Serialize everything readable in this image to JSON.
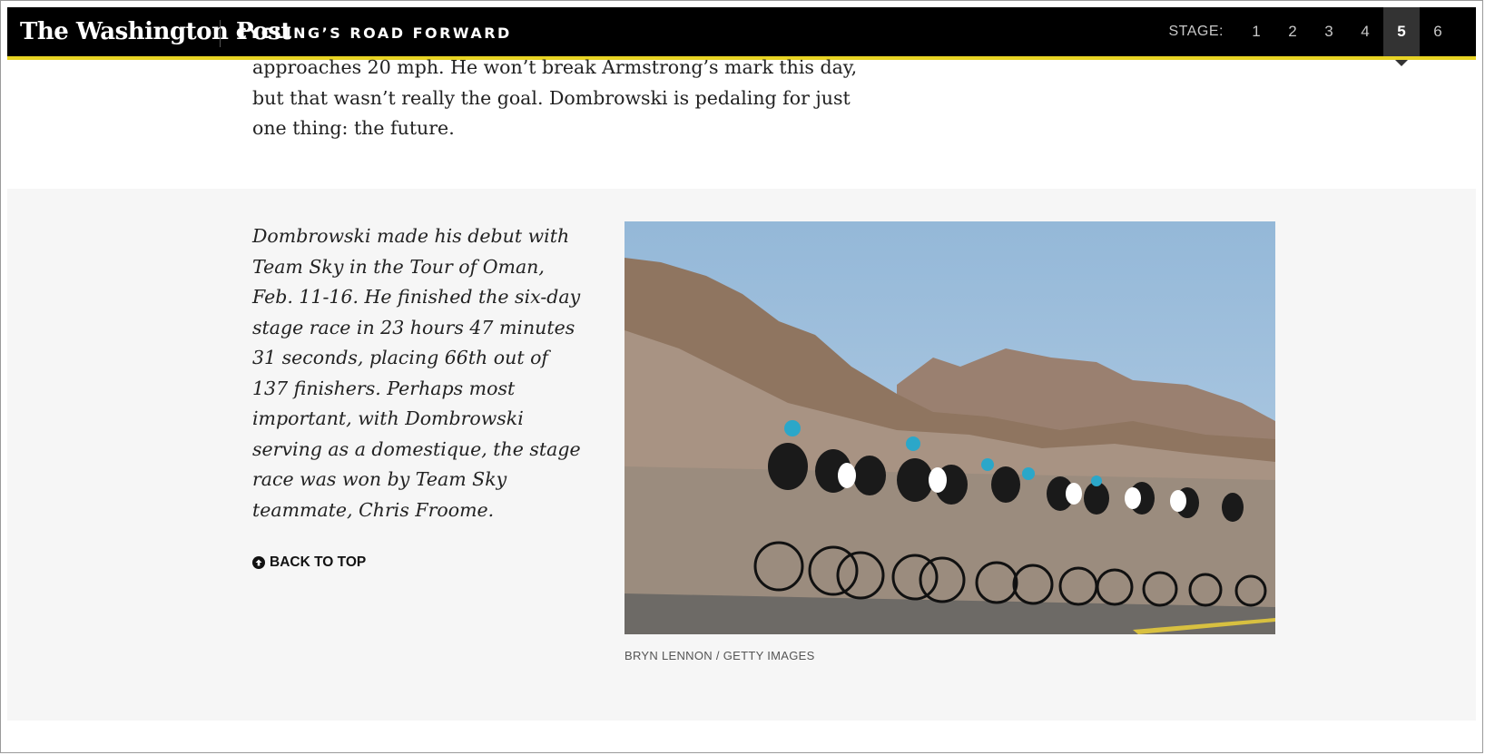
{
  "header": {
    "logo_text": "The Washington Post",
    "series_title": "CYCLING’S ROAD FORWARD",
    "stage_label": "STAGE:",
    "stages": [
      "1",
      "2",
      "3",
      "4",
      "5",
      "6"
    ],
    "active_stage": "5",
    "accent_color": "#e8d323"
  },
  "article": {
    "intro_paragraph": "approaches 20 mph. He won’t break Armstrong’s mark this day, but that wasn’t really the goal. Dombrowski is pedaling for just one thing: the future.",
    "sidebar_text": "Dombrowski made his debut with Team Sky in the Tour of Oman, Feb. 11-16. He finished the six-day stage race in 23 hours 47 minutes 31 seconds, placing 66th out of 137 finishers. Perhaps most important, with Dombrowski serving as a domestique, the stage race was won by Team Sky teammate, Chris Froome.",
    "back_to_top_label": "BACK TO TOP",
    "back_to_top_icon": "arrow-up-circle-icon",
    "photo_credit": "BRYN LENNON / GETTY IMAGES"
  }
}
